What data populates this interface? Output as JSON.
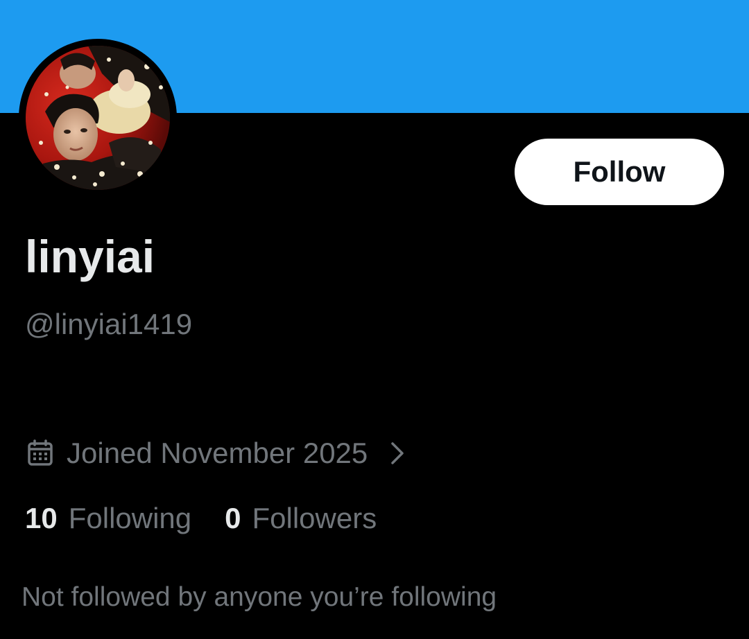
{
  "theme": {
    "banner_color": "#1d9bf0",
    "background_color": "#000000",
    "primary_text_color": "#e7e9ea",
    "secondary_text_color": "#71767b",
    "follow_button_bg": "#ffffff",
    "follow_button_text": "#0f1419"
  },
  "profile": {
    "display_name": "linyiai",
    "handle": "@linyiai1419",
    "avatar_icon": "profile-photo",
    "joined": "Joined November 2025",
    "joined_icon": "calendar-icon",
    "joined_chevron_icon": "chevron-right-icon"
  },
  "actions": {
    "follow_label": "Follow"
  },
  "stats": {
    "following_count": "10",
    "following_label": "Following",
    "followers_count": "0",
    "followers_label": "Followers"
  },
  "social_context": {
    "text": "Not followed by anyone you’re following"
  }
}
